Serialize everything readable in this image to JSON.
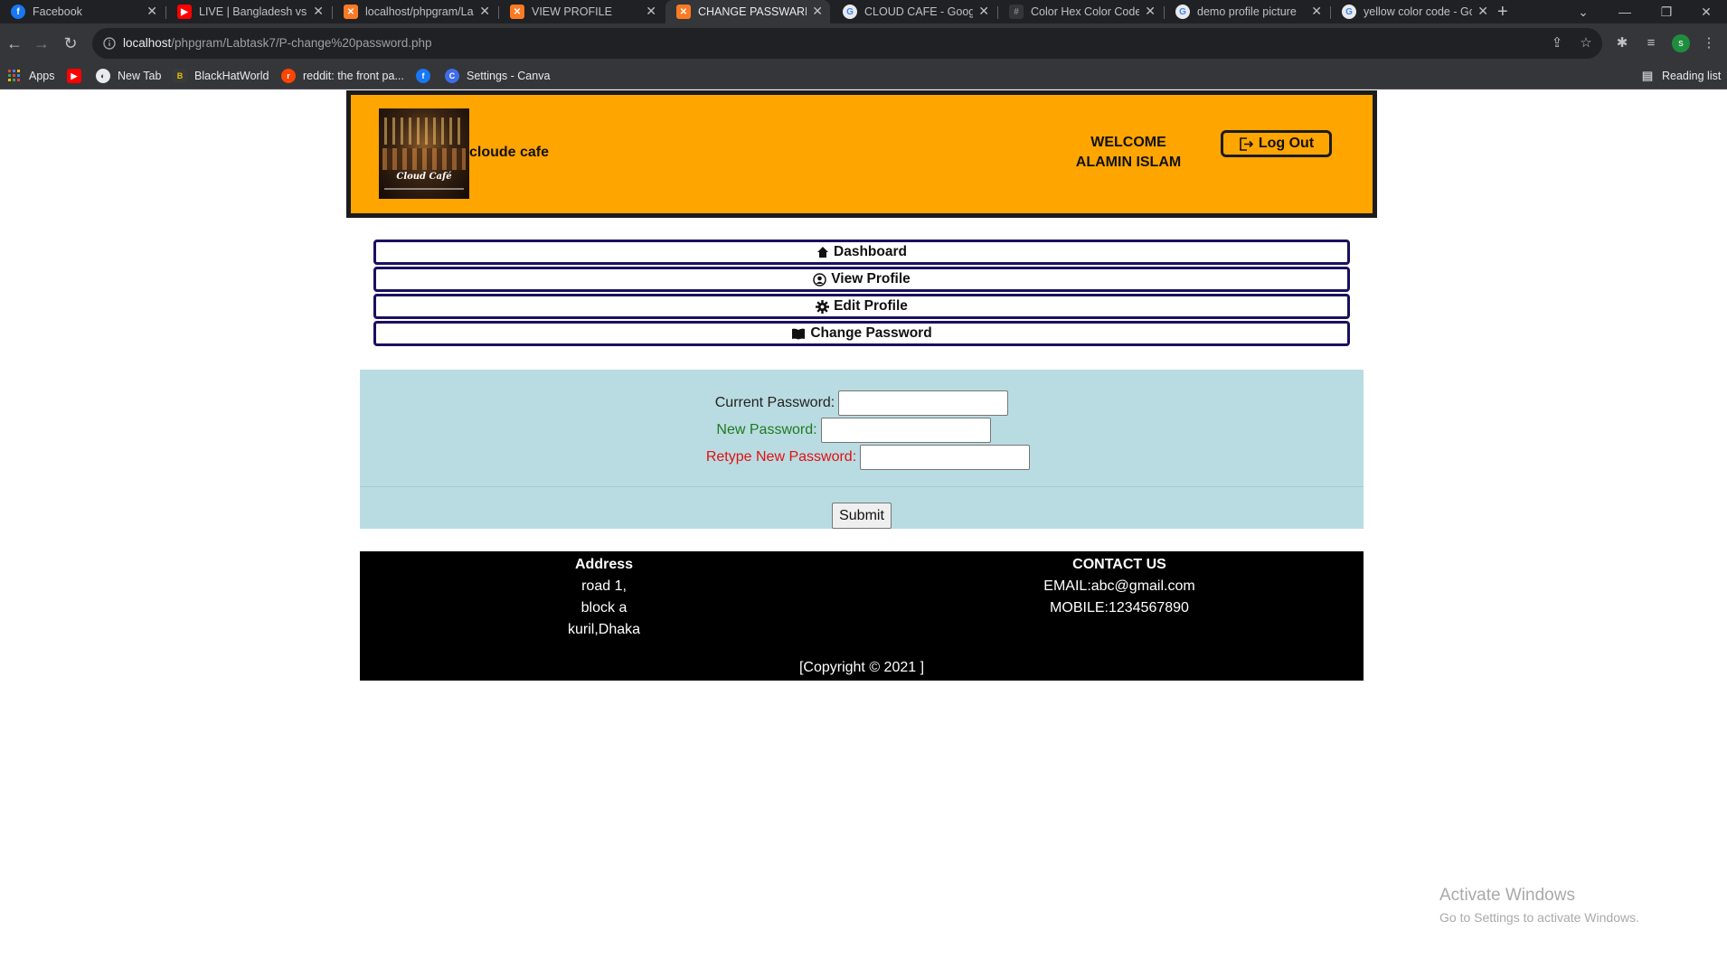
{
  "browser": {
    "tabs": [
      {
        "title": "Facebook",
        "favicon": "facebook-icon",
        "active": false
      },
      {
        "title": "LIVE | Bangladesh vs P",
        "favicon": "youtube-icon",
        "active": false
      },
      {
        "title": "localhost/phpgram/La",
        "favicon": "xampp-icon",
        "active": false
      },
      {
        "title": "VIEW PROFILE",
        "favicon": "xampp-icon",
        "active": false
      },
      {
        "title": "CHANGE PASSWARD",
        "favicon": "xampp-icon",
        "active": true
      },
      {
        "title": "CLOUD CAFE - Google",
        "favicon": "google-icon",
        "active": false
      },
      {
        "title": "Color Hex Color Code",
        "favicon": "colorhex-icon",
        "active": false
      },
      {
        "title": "demo profile picture",
        "favicon": "google-icon",
        "active": false
      },
      {
        "title": "yellow color code - Gc",
        "favicon": "google-icon",
        "active": false
      }
    ],
    "url_host": "localhost",
    "url_path": "/phpgram/Labtask7/P-change%20password.php",
    "profile_initial": "s",
    "bookmarks": [
      {
        "label": "Apps",
        "icon": "apps-grid-icon"
      },
      {
        "label": "",
        "icon": "youtube-icon"
      },
      {
        "label": "New Tab",
        "icon": "chrome-icon"
      },
      {
        "label": "BlackHatWorld",
        "icon": "blackhatworld-icon"
      },
      {
        "label": "reddit: the front pa...",
        "icon": "reddit-icon"
      },
      {
        "label": "",
        "icon": "facebook-icon"
      },
      {
        "label": "Settings - Canva",
        "icon": "canva-icon"
      }
    ],
    "reading_list": "Reading list"
  },
  "header": {
    "brand": "cloude cafe",
    "logo_text": "Cloud Café",
    "welcome_line1": "WELCOME",
    "welcome_line2": "ALAMIN ISLAM",
    "logout_label": "Log Out"
  },
  "nav": [
    {
      "label": "Dashboard",
      "icon": "home-icon"
    },
    {
      "label": "View Profile",
      "icon": "user-circle-icon"
    },
    {
      "label": "Edit Profile",
      "icon": "gear-icon"
    },
    {
      "label": "Change Password",
      "icon": "book-icon"
    }
  ],
  "form": {
    "current_label": "Current Password:",
    "new_label": "New Password:",
    "retype_label": "Retype New Password:",
    "submit_label": "Submit",
    "colors": {
      "current": "#222222",
      "new": "#1e7a1e",
      "retype": "#e01010"
    }
  },
  "footer": {
    "address_title": "Address",
    "address_lines": [
      "road 1,",
      "block a",
      "kuril,Dhaka"
    ],
    "contact_title": "CONTACT US",
    "email": "EMAIL:abc@gmail.com",
    "mobile": "MOBILE:1234567890",
    "copyright": "[Copyright © 2021 ]"
  },
  "watermark": {
    "line1": "Activate Windows",
    "line2": "Go to Settings to activate Windows."
  },
  "colors": {
    "header_bg": "#ffa500",
    "form_bg": "#b9dce2",
    "nav_border": "#1a1060",
    "footer_bg": "#000000"
  }
}
